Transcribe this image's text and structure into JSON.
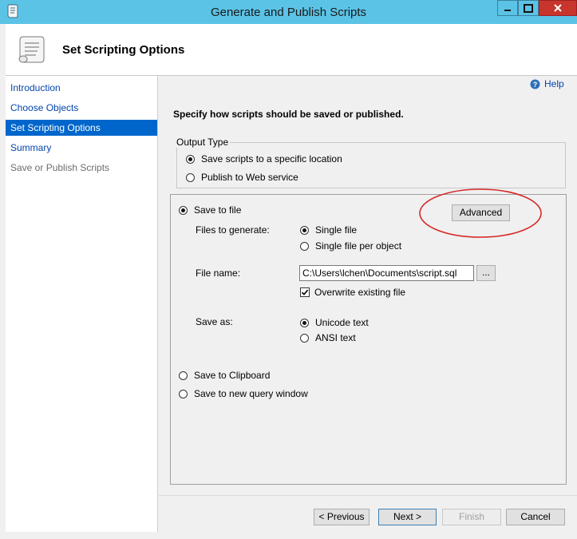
{
  "window": {
    "title": "Generate and Publish Scripts"
  },
  "header": {
    "title": "Set Scripting Options"
  },
  "nav": {
    "items": [
      {
        "label": "Introduction"
      },
      {
        "label": "Choose Objects"
      },
      {
        "label": "Set Scripting Options"
      },
      {
        "label": "Summary"
      },
      {
        "label": "Save or Publish Scripts"
      }
    ]
  },
  "help": {
    "label": "Help"
  },
  "main": {
    "instruction": "Specify how scripts should be saved or published.",
    "output_type": {
      "legend": "Output Type",
      "opt_location": "Save scripts to a specific location",
      "opt_web": "Publish to Web service",
      "selected": "Save scripts to a specific location"
    },
    "save_to_file": {
      "label": "Save to file",
      "advanced_button": "Advanced",
      "files_to_generate_label": "Files to generate:",
      "single_file": "Single file",
      "single_file_per_object": "Single file per object",
      "file_name_label": "File name:",
      "file_name_value": "C:\\Users\\lchen\\Documents\\script.sql",
      "browse_button": "...",
      "overwrite_label": "Overwrite existing file",
      "overwrite_checked": true,
      "save_as_label": "Save as:",
      "unicode_text": "Unicode text",
      "ansi_text": "ANSI text"
    },
    "save_to_clipboard": "Save to Clipboard",
    "save_to_query_window": "Save to new query window"
  },
  "footer": {
    "previous": "< Previous",
    "next": "Next >",
    "finish": "Finish",
    "cancel": "Cancel"
  },
  "colors": {
    "title_bar": "#5bc3e6",
    "nav_selected": "#0066cc",
    "annotation_circle": "#d62828"
  }
}
